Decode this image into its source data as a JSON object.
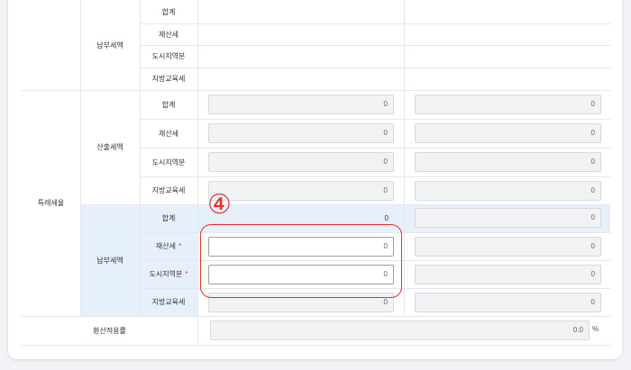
{
  "section_a": {
    "group_label": "납부세액",
    "rows": [
      "합계",
      "재산세",
      "도시지역분",
      "지방교육세"
    ]
  },
  "section_b": {
    "title": "특례세율",
    "calc": {
      "group_label": "산출세액",
      "rows": [
        {
          "label": "합계",
          "v1": "0",
          "v2": "0"
        },
        {
          "label": "재산세",
          "v1": "0",
          "v2": "0"
        },
        {
          "label": "도시지역분",
          "v1": "0",
          "v2": "0"
        },
        {
          "label": "지방교육세",
          "v1": "0",
          "v2": "0"
        }
      ]
    },
    "pay": {
      "group_label": "납부세액",
      "rows": [
        {
          "label": "합계",
          "v1": "0",
          "v2": "0",
          "required": false
        },
        {
          "label": "재산세",
          "v1": "0",
          "v2": "0",
          "required": true
        },
        {
          "label": "도시지역분",
          "v1": "0",
          "v2": "0",
          "required": true
        },
        {
          "label": "지방교육세",
          "v1": "0",
          "v2": "0",
          "required": false
        }
      ]
    }
  },
  "conversion": {
    "label": "환산적용률",
    "value": "0.0",
    "unit": "%"
  },
  "required_mark": "*",
  "callout_number": "④",
  "colors": {
    "accent_red": "#e4312b",
    "highlight_blue": "#e6f0fa"
  }
}
